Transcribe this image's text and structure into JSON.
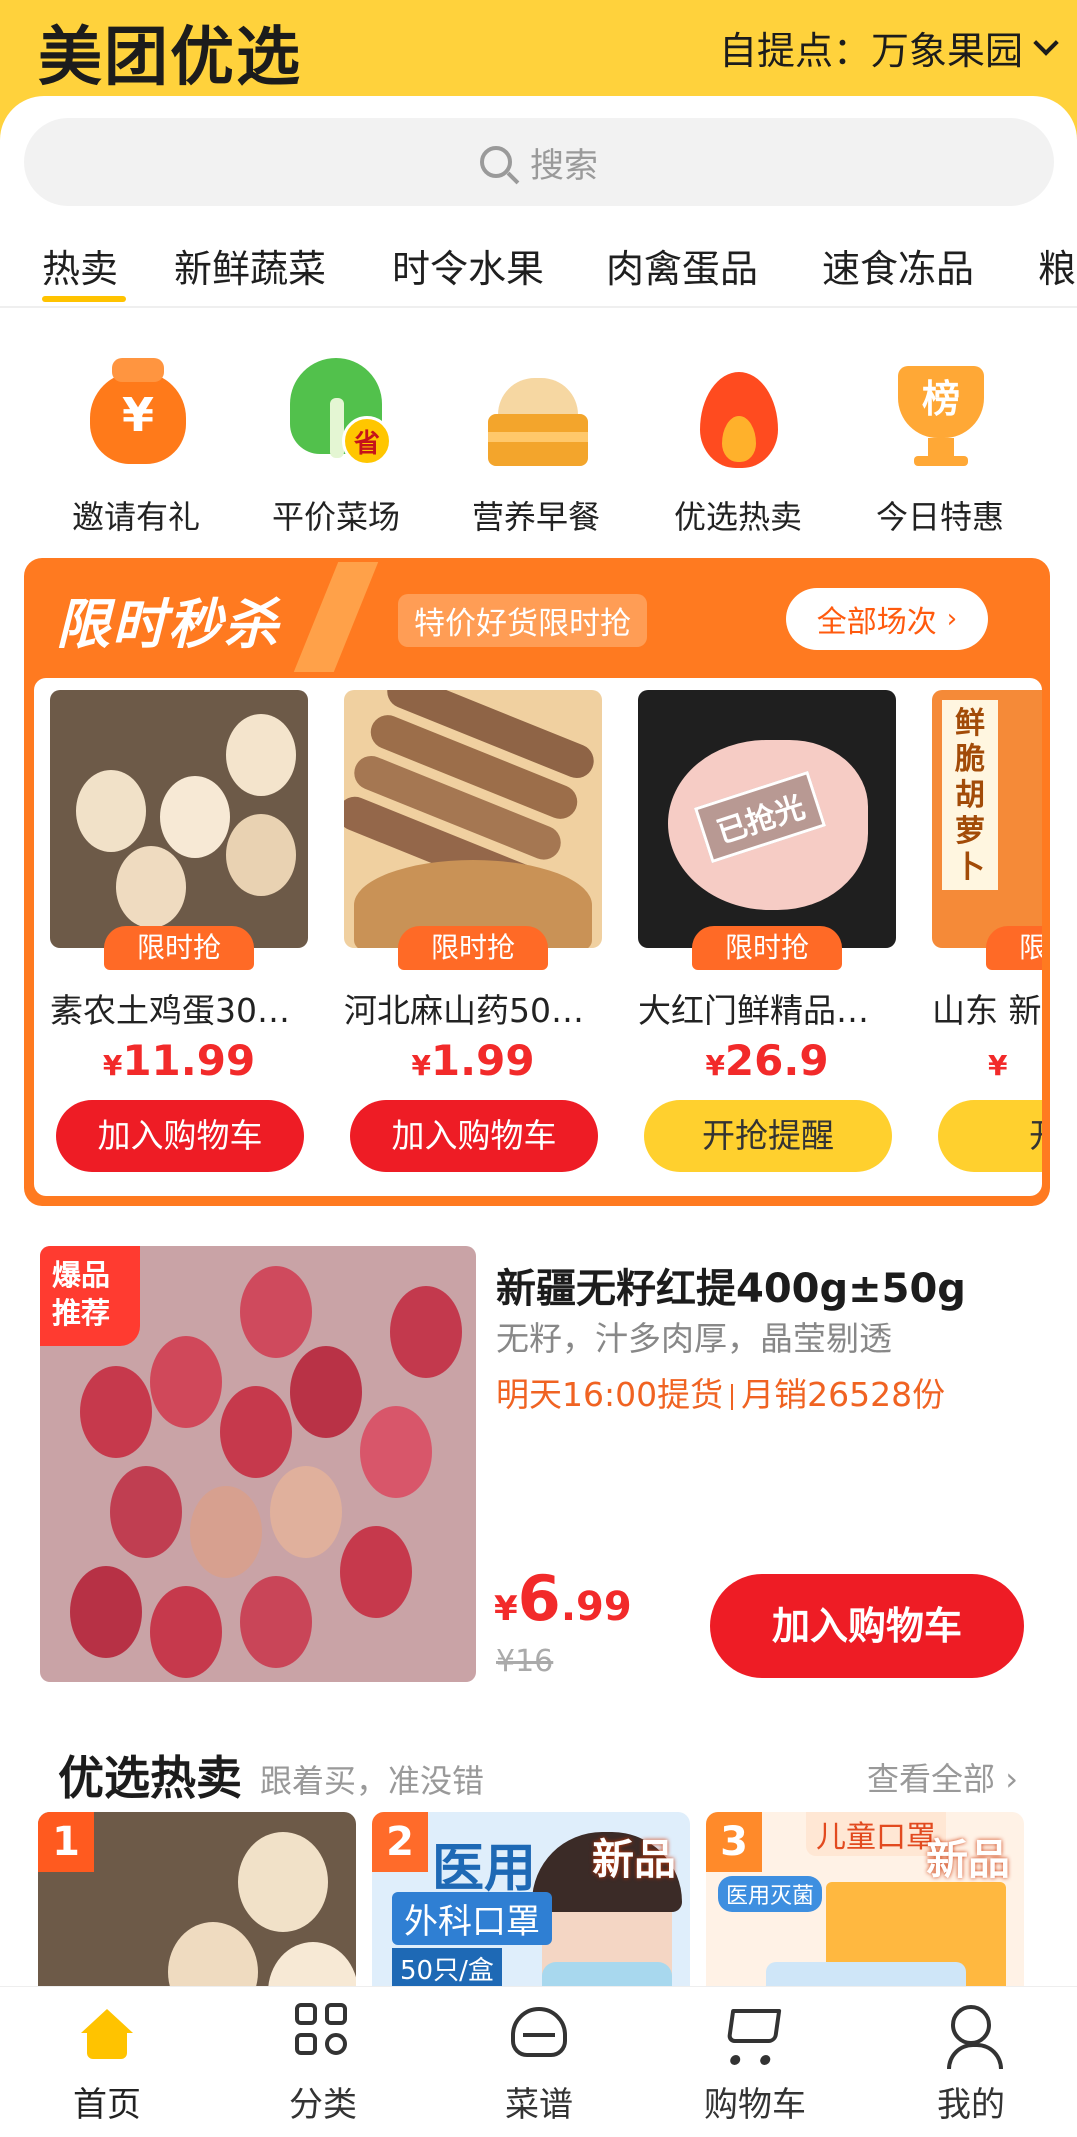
{
  "header": {
    "logo": "美团优选",
    "pickup_label": "自提点：万象果园"
  },
  "search": {
    "placeholder": "搜索"
  },
  "tabs": [
    "热卖",
    "新鲜蔬菜",
    "时令水果",
    "肉禽蛋品",
    "速食冻品",
    "粮"
  ],
  "quick_links": [
    {
      "label": "邀请有礼",
      "icon": "money-bag-icon"
    },
    {
      "label": "平价菜场",
      "icon": "vegetable-icon"
    },
    {
      "label": "营养早餐",
      "icon": "bun-icon"
    },
    {
      "label": "优选热卖",
      "icon": "flame-icon"
    },
    {
      "label": "今日特惠",
      "icon": "trophy-icon"
    }
  ],
  "quick_badges": {
    "vegetable": "省",
    "money": "¥",
    "trophy": "榜"
  },
  "flash_sale": {
    "title": "限时秒杀",
    "subtitle": "特价好货限时抢",
    "all_label": "全部场次",
    "badge": "限时抢",
    "sold_out": "已抢光",
    "items": [
      {
        "name": "素农土鸡蛋30…",
        "currency": "¥",
        "price": "11.99",
        "button": "加入购物车"
      },
      {
        "name": "河北麻山药50…",
        "currency": "¥",
        "price": "1.99",
        "button": "加入购物车"
      },
      {
        "name": "大红门鲜精品…",
        "currency": "¥",
        "price": "26.9",
        "button": "开抢提醒"
      },
      {
        "name": "山东 新",
        "currency": "¥",
        "price": "",
        "button": "开抢"
      }
    ],
    "carrot_tag": "鲜脆胡萝卜"
  },
  "featured": {
    "badge_line1": "爆品",
    "badge_line2": "推荐",
    "title": "新疆无籽红提400g±50g",
    "desc": "无籽，汁多肉厚，晶莹剔透",
    "pickup": "明天16:00提货",
    "sales": "月销26528份",
    "currency": "¥",
    "price_int": "6",
    "price_dec": ".99",
    "original": "¥16",
    "button": "加入购物车"
  },
  "hot": {
    "title": "优选热卖",
    "subtitle": "跟着买，准没错",
    "view_all": "查看全部",
    "cards": [
      {
        "rank": "1",
        "tag": ""
      },
      {
        "rank": "2",
        "tag": "新品",
        "line1": "医用",
        "line2": "外科口罩",
        "count": "50只/盒"
      },
      {
        "rank": "3",
        "tag": "新品",
        "line1": "儿童口罩",
        "line2": "医用灭菌"
      }
    ]
  },
  "bottom_nav": [
    {
      "label": "首页",
      "icon": "home-icon"
    },
    {
      "label": "分类",
      "icon": "category-icon"
    },
    {
      "label": "菜谱",
      "icon": "recipe-icon"
    },
    {
      "label": "购物车",
      "icon": "cart-icon"
    },
    {
      "label": "我的",
      "icon": "profile-icon"
    }
  ],
  "colors": {
    "brand_yellow": "#ffd23c",
    "price_red": "#f22a2a",
    "button_red": "#ee1c25",
    "flash_orange": "#ff7a20"
  }
}
